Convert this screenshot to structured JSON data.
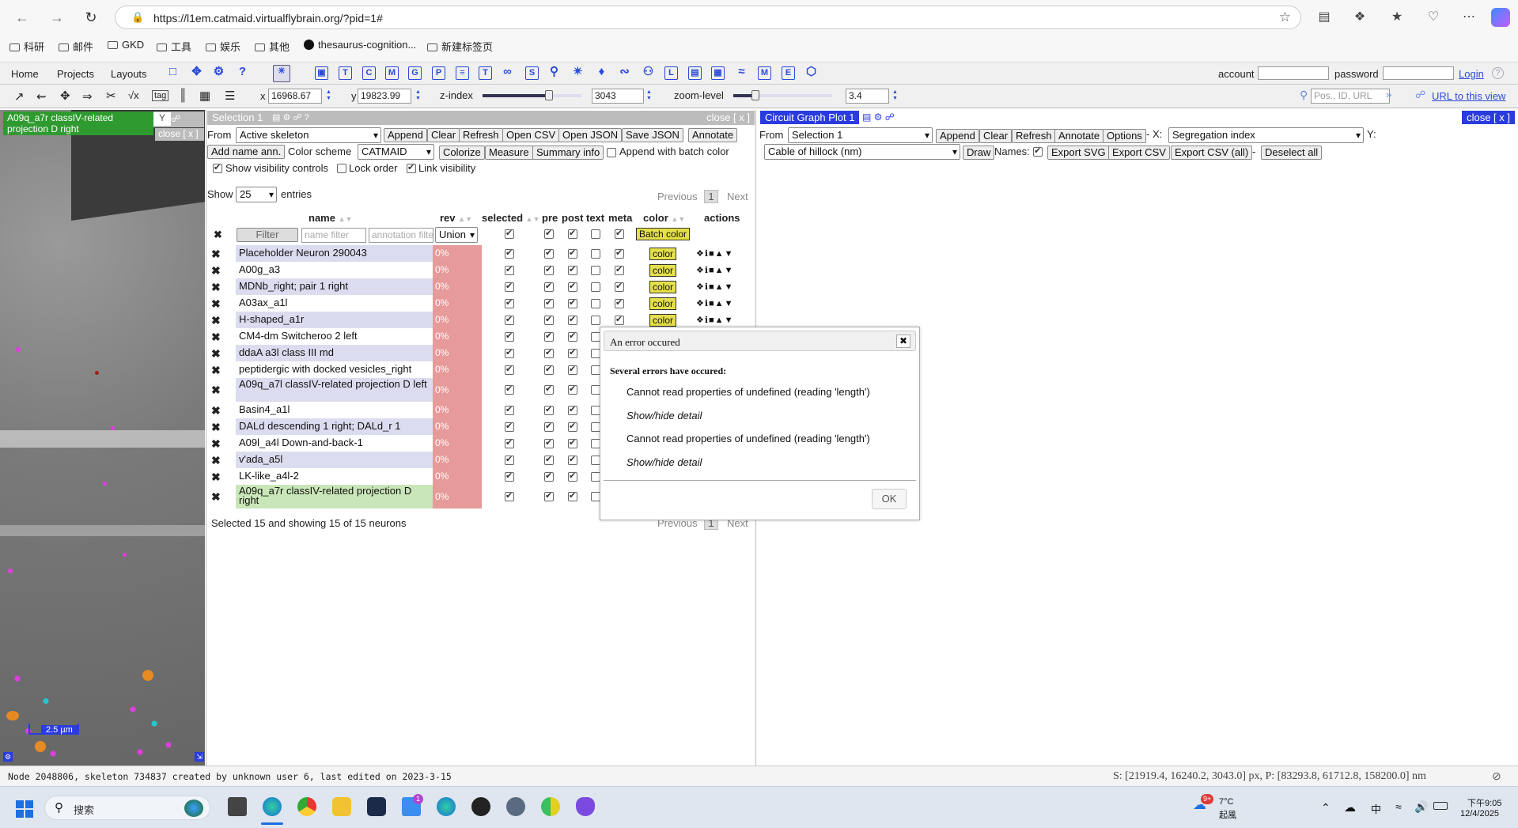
{
  "browser": {
    "url": "https://l1em.catmaid.virtualflybrain.org/?pid=1#",
    "bookmarks": [
      "科研",
      "邮件",
      "GKD",
      "工具",
      "娱乐",
      "其他",
      "thesaurus-cognition...",
      "新建标签页"
    ]
  },
  "menu": {
    "items": [
      "Home",
      "Projects",
      "Layouts"
    ],
    "account_label": "account",
    "password_label": "password",
    "login": "Login"
  },
  "nav": {
    "x_label": "x",
    "x_value": "16968.67",
    "y_label": "y",
    "y_value": "19823.99",
    "z_label": "z-index",
    "z_value": "3043",
    "zoom_label": "zoom-level",
    "zoom_value": "3.4",
    "search_placeholder": "Pos., ID, URL",
    "url_link": "URL to this view",
    "z_slider_percent": 67,
    "zoom_slider_percent": 22
  },
  "stack": {
    "title": "A09q_a7r classIV-related projection D right",
    "close": "close [ x ]",
    "scale": "2.5 µm"
  },
  "selection": {
    "title": "Selection 1",
    "close": "close [ x ]",
    "from_label": "From",
    "from_value": "Active skeleton",
    "buttons1": [
      "Append",
      "Clear",
      "Refresh",
      "Open CSV",
      "Open JSON",
      "Save JSON",
      "Annotate"
    ],
    "add_name": "Add name ann.",
    "color_scheme_label": "Color scheme",
    "color_scheme_value": "CATMAID",
    "buttons2": [
      "Colorize",
      "Measure",
      "Summary info"
    ],
    "append_batch": "Append with batch color",
    "show_visibility": "Show visibility controls",
    "lock_order": "Lock order",
    "link_visibility": "Link visibility",
    "show_label": "Show",
    "show_value": "25",
    "entries_label": "entries",
    "prev": "Previous",
    "page": "1",
    "next": "Next",
    "headers": [
      "name",
      "rev",
      "selected",
      "pre",
      "post",
      "text",
      "meta",
      "color",
      "actions"
    ],
    "filter_btn": "Filter",
    "name_filter": "name filter",
    "annotation_filter": "annotation filter",
    "union": "Union",
    "batch_color": "Batch color",
    "color_label": "color",
    "rows": [
      {
        "name": "Placeholder Neuron 290043",
        "rev": "0%",
        "text": false,
        "meta": true
      },
      {
        "name": "A00g_a3",
        "rev": "0%",
        "text": false,
        "meta": true
      },
      {
        "name": "MDNb_right; pair 1 right",
        "rev": "0%",
        "text": false,
        "meta": true
      },
      {
        "name": "A03ax_a1l",
        "rev": "0%",
        "text": false,
        "meta": true
      },
      {
        "name": "H-shaped_a1r",
        "rev": "0%",
        "text": false,
        "meta": true
      },
      {
        "name": "CM4-dm Switcheroo 2 left",
        "rev": "0%",
        "text": false,
        "meta": true
      },
      {
        "name": "ddaA a3l class III md",
        "rev": "0%",
        "text": false,
        "meta": true
      },
      {
        "name": "peptidergic with docked vesicles_right",
        "rev": "0%",
        "text": false,
        "meta": true
      },
      {
        "name": "A09q_a7l classIV-related projection D left",
        "rev": "0%",
        "text": false,
        "meta": true
      },
      {
        "name": "Basin4_a1l",
        "rev": "0%",
        "text": false,
        "meta": true
      },
      {
        "name": "DALd descending 1 right; DALd_r 1",
        "rev": "0%",
        "text": false,
        "meta": true
      },
      {
        "name": "A09l_a4l Down-and-back-1",
        "rev": "0%",
        "text": false,
        "meta": true
      },
      {
        "name": "v'ada_a5l",
        "rev": "0%",
        "text": false,
        "meta": true
      },
      {
        "name": "LK-like_a4l-2",
        "rev": "0%",
        "text": false,
        "meta": true
      },
      {
        "name": "A09q_a7r classIV-related projection D right",
        "rev": "0%",
        "text": false,
        "meta": true
      }
    ],
    "footer": "Selected 15 and showing 15 of 15 neurons"
  },
  "graph": {
    "title": "Circuit Graph Plot 1",
    "close": "close [ x ]",
    "from_label": "From",
    "from_value": "Selection 1",
    "buttons": [
      "Append",
      "Clear",
      "Refresh",
      "Annotate",
      "Options"
    ],
    "x_label": "- X:",
    "x_value": "Segregation index",
    "y_label": "Y:",
    "measure_value": "Cable of hillock (nm)",
    "draw": "Draw",
    "names_label": "Names:",
    "buttons2": [
      "Export SVG",
      "Export CSV",
      "Export CSV (all)"
    ],
    "dash": "-",
    "deselect": "Deselect all"
  },
  "dialog": {
    "title": "An error occured",
    "summary": "Several errors have occured:",
    "errors": [
      "Cannot read properties of undefined (reading 'length')",
      "Cannot read properties of undefined (reading 'length')"
    ],
    "detail": "Show/hide detail",
    "ok": "OK"
  },
  "status": {
    "left": "Node 2048806, skeleton 734837 created by unknown user 6, last edited on 2023-3-15",
    "right": "S: [21919.4, 16240.2, 3043.0] px, P: [83293.8, 61712.8, 158200.0] nm"
  },
  "taskbar": {
    "search": "搜索",
    "badge": "9+",
    "temp": "7°C",
    "weather": "起風",
    "ime": "中",
    "time": "下午9:05",
    "date": "12/4/2025",
    "badge_count": "1"
  }
}
